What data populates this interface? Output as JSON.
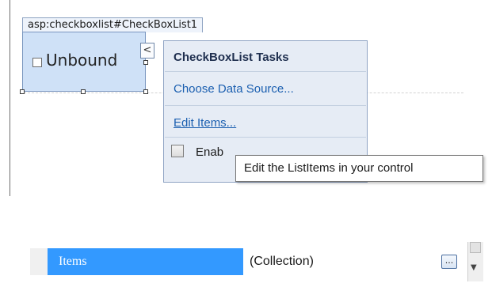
{
  "designer": {
    "control_tag": "asp:checkboxlist#CheckBoxList1",
    "control_item_label": "Unbound",
    "smart_tag_glyph": "<"
  },
  "tasks_panel": {
    "title": "CheckBoxList Tasks",
    "choose_data_source": "Choose Data Source...",
    "edit_items": "Edit Items...",
    "enable_autopostback_visible": "Enab",
    "enable_autopostback_checked": false
  },
  "tooltip": {
    "text": "Edit the ListItems in your control"
  },
  "property_grid": {
    "name": "Items",
    "value": "(Collection)",
    "ellipsis_glyph": "...",
    "scroll_down_glyph": "▼"
  },
  "colors": {
    "selection": "#3399ff",
    "link": "#1b5fb0",
    "panel_bg": "#e6ecf5",
    "control_bg": "#cfe1f7"
  }
}
